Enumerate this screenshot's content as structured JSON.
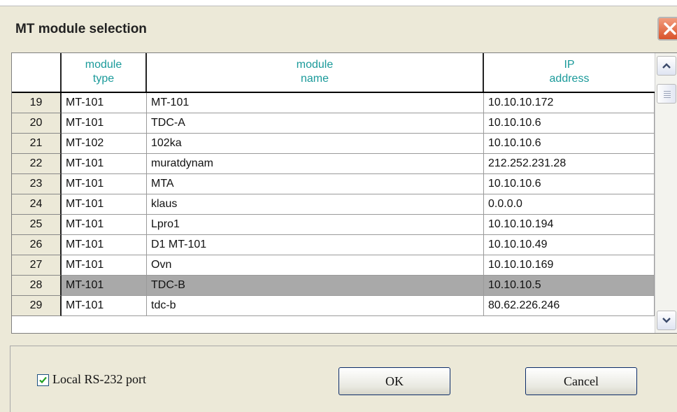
{
  "window": {
    "title": "MT module selection"
  },
  "table": {
    "headers": [
      {
        "line1": "module",
        "line2": "type"
      },
      {
        "line1": "module",
        "line2": "name"
      },
      {
        "line1": "IP",
        "line2": "address"
      }
    ],
    "rows": [
      {
        "num": "19",
        "type": "MT-101",
        "name": "MT-101",
        "ip": "10.10.10.172"
      },
      {
        "num": "20",
        "type": "MT-101",
        "name": "TDC-A",
        "ip": "10.10.10.6"
      },
      {
        "num": "21",
        "type": "MT-102",
        "name": "102ka",
        "ip": "10.10.10.6"
      },
      {
        "num": "22",
        "type": "MT-101",
        "name": "muratdynam",
        "ip": "212.252.231.28"
      },
      {
        "num": "23",
        "type": "MT-101",
        "name": "MTA",
        "ip": "10.10.10.6"
      },
      {
        "num": "24",
        "type": "MT-101",
        "name": "klaus",
        "ip": "0.0.0.0"
      },
      {
        "num": "25",
        "type": "MT-101",
        "name": "Lpro1",
        "ip": "10.10.10.194"
      },
      {
        "num": "26",
        "type": "MT-101",
        "name": "D1 MT-101",
        "ip": "10.10.10.49"
      },
      {
        "num": "27",
        "type": "MT-101",
        "name": "Ovn",
        "ip": "10.10.10.169"
      },
      {
        "num": "28",
        "type": "MT-101",
        "name": "TDC-B",
        "ip": "10.10.10.5",
        "selected": true
      },
      {
        "num": "29",
        "type": "MT-101",
        "name": "tdc-b",
        "ip": "80.62.226.246"
      }
    ]
  },
  "options": {
    "local_port_label": "Local RS-232 port",
    "local_port_checked": true
  },
  "buttons": {
    "ok": "OK",
    "cancel": "Cancel"
  },
  "colors": {
    "header_text": "#1a9a9a",
    "selected_row": "#a9a9a9",
    "dialog_bg": "#ece9d8"
  }
}
